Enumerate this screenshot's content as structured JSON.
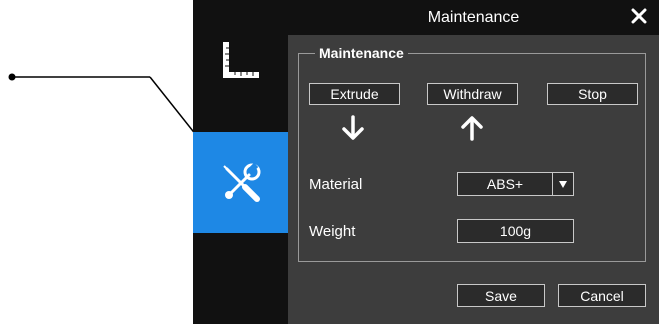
{
  "window": {
    "title": "Maintenance",
    "close_icon": "close-icon"
  },
  "sidebar": {
    "items": [
      {
        "icon": "ruler-icon",
        "active": false
      },
      {
        "icon": "tools-icon",
        "active": true
      }
    ],
    "active_color": "#1e88e5"
  },
  "group": {
    "legend": "Maintenance"
  },
  "actions": {
    "extrude_label": "Extrude",
    "withdraw_label": "Withdraw",
    "stop_label": "Stop",
    "extrude_arrow_icon": "arrow-down-icon",
    "withdraw_arrow_icon": "arrow-up-icon"
  },
  "material": {
    "label": "Material",
    "value": "ABS+"
  },
  "weight": {
    "label": "Weight",
    "value": "100g"
  },
  "footer": {
    "save_label": "Save",
    "cancel_label": "Cancel"
  }
}
